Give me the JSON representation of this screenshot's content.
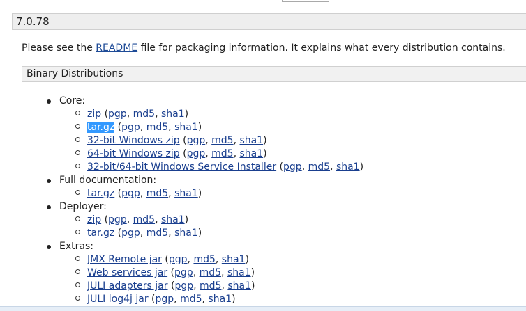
{
  "version": {
    "title": "7.0.78"
  },
  "intro": {
    "before": "Please see the ",
    "link": "README",
    "after": " file for packaging information. It explains what every distribution contains."
  },
  "binary": {
    "title": "Binary Distributions"
  },
  "sections": {
    "core": {
      "label": "Core:",
      "items": [
        {
          "name": "zip",
          "pgp": "pgp",
          "md5": "md5",
          "sha1": "sha1"
        },
        {
          "name": "tar.gz",
          "pgp": "pgp",
          "md5": "md5",
          "sha1": "sha1"
        },
        {
          "name": "32-bit Windows zip",
          "pgp": "pgp",
          "md5": "md5",
          "sha1": "sha1"
        },
        {
          "name": "64-bit Windows zip",
          "pgp": "pgp",
          "md5": "md5",
          "sha1": "sha1"
        },
        {
          "name": "32-bit/64-bit Windows Service Installer",
          "pgp": "pgp",
          "md5": "md5",
          "sha1": "sha1"
        }
      ]
    },
    "docs": {
      "label": "Full documentation:",
      "items": [
        {
          "name": "tar.gz",
          "pgp": "pgp",
          "md5": "md5",
          "sha1": "sha1"
        }
      ]
    },
    "deployer": {
      "label": "Deployer:",
      "items": [
        {
          "name": "zip",
          "pgp": "pgp",
          "md5": "md5",
          "sha1": "sha1"
        },
        {
          "name": "tar.gz",
          "pgp": "pgp",
          "md5": "md5",
          "sha1": "sha1"
        }
      ]
    },
    "extras": {
      "label": "Extras:",
      "items": [
        {
          "name": "JMX Remote jar",
          "pgp": "pgp",
          "md5": "md5",
          "sha1": "sha1"
        },
        {
          "name": "Web services jar",
          "pgp": "pgp",
          "md5": "md5",
          "sha1": "sha1"
        },
        {
          "name": "JULI adapters jar",
          "pgp": "pgp",
          "md5": "md5",
          "sha1": "sha1"
        },
        {
          "name": "JULI log4j jar",
          "pgp": "pgp",
          "md5": "md5",
          "sha1": "sha1"
        }
      ]
    }
  },
  "punct": {
    "open": " (",
    "comma": ", ",
    "close": ")"
  },
  "colors": {
    "link": "#1a3f8f",
    "selection": "#3399ff",
    "header_bg": "#eeeeee"
  }
}
